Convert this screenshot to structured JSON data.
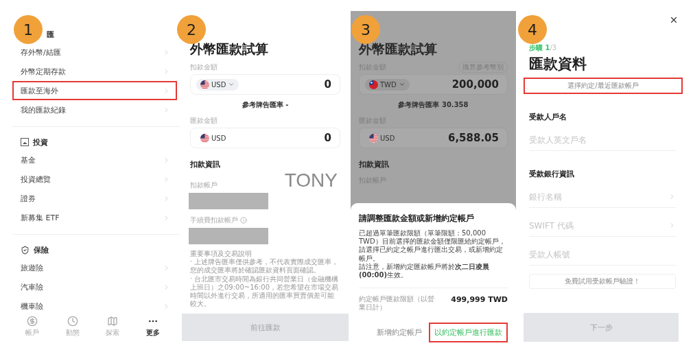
{
  "menu_screen": {
    "step": "1",
    "sections": [
      {
        "title": "匯",
        "items": [
          {
            "label": "存外幣/結匯",
            "highlighted": false
          },
          {
            "label": "外幣定期存款",
            "highlighted": false
          },
          {
            "label": "匯款至海外",
            "highlighted": true
          },
          {
            "label": "我的匯款紀錄",
            "highlighted": false
          }
        ]
      },
      {
        "title": "投資",
        "items": [
          {
            "label": "基金",
            "highlighted": false
          },
          {
            "label": "投資總覽",
            "highlighted": false
          },
          {
            "label": "證券",
            "highlighted": false
          },
          {
            "label": "新募集 ETF",
            "highlighted": false
          }
        ]
      },
      {
        "title": "保險",
        "items": [
          {
            "label": "旅遊險",
            "highlighted": false
          },
          {
            "label": "汽車險",
            "highlighted": false
          },
          {
            "label": "機車險",
            "highlighted": false
          }
        ]
      }
    ],
    "tab_bar": [
      {
        "label": "帳戶",
        "selected": false
      },
      {
        "label": "動態",
        "selected": false
      },
      {
        "label": "探索",
        "selected": false
      },
      {
        "label": "更多",
        "selected": true
      }
    ]
  },
  "calculator_screen": {
    "step": "2",
    "title": "外幣匯款試算",
    "debit_label": "扣款金額",
    "debit_currency": "USD",
    "debit_amount": "0",
    "rate": "參考牌告匯率 -",
    "remit_label": "匯款金額",
    "remit_currency": "USD",
    "remit_amount": "0",
    "section_title": "扣款資訊",
    "overlay_text": "TONY",
    "account_label": "扣款帳戶",
    "fee_account_label": "手續費扣款帳戶",
    "notes_title": "重要事項及交易說明",
    "notes": [
      "‧ 上述牌告匯率僅供參考，不代表實際成交匯率，您的成交匯率將於確認匯款資料頁面確認。",
      "‧ 台北匯市交易時間為銀行共同營業日（金融機構上班日）之09:00~16:00，若您希望在市場交易時間以外進行交易，所適用的匯率買賣價差可能較大。"
    ],
    "submit_button": {
      "label": "前往匯款",
      "disabled": true
    }
  },
  "dialog_screen": {
    "step": "3",
    "background": {
      "title": "外幣匯款試算",
      "debit_label": "扣款金額",
      "convert_pill": "換算參考幣別",
      "debit_currency": "TWD",
      "debit_amount": "200,000",
      "rate": "參考牌告匯率 30.358",
      "remit_label": "匯款金額",
      "remit_currency": "USD",
      "remit_amount": "6,588.05",
      "section_title": "扣款資訊",
      "account_label": "扣款帳戶"
    },
    "sheet": {
      "title": "請調整匯款金額或新增約定帳戶",
      "paragraphs": [
        "已超過單筆匯款限額（單筆限額：50,000 TWD）目前選擇的匯款金額僅限匯給約定帳戶，請選擇已約定之帳戶進行匯出交易，或新增約定帳戶。",
        "請注意，新增約定匯款帳戶將於**次二日凌晨 (00:00)**生效。"
      ],
      "limit_label": "約定帳戶匯款限額（以營業日計）",
      "limit_value": "499,999 TWD",
      "buttons": [
        {
          "label": "新增約定帳戶",
          "kind": "secondary",
          "highlighted": false
        },
        {
          "label": "以約定帳戶進行匯款",
          "kind": "primary",
          "highlighted": true
        }
      ]
    }
  },
  "form_screen": {
    "step": "4",
    "step_current": "步驟 1",
    "step_total": "/3",
    "title": "匯款資料",
    "pick_button": {
      "label": "選擇約定/最近匯款帳戶",
      "highlighted": true
    },
    "groups": [
      {
        "heading": "受款人戶名",
        "fields": [
          {
            "placeholder": "受款人英文戶名",
            "kind": "text"
          }
        ]
      },
      {
        "heading": "受款銀行資訊",
        "fields": [
          {
            "placeholder": "銀行名稱",
            "kind": "select"
          },
          {
            "placeholder": "SWIFT 代碼",
            "kind": "select"
          },
          {
            "placeholder": "受款人帳號",
            "kind": "text"
          }
        ]
      }
    ],
    "verify_button": "免費試用受款帳戶驗證！",
    "next_button": {
      "label": "下一步",
      "disabled": true
    }
  }
}
